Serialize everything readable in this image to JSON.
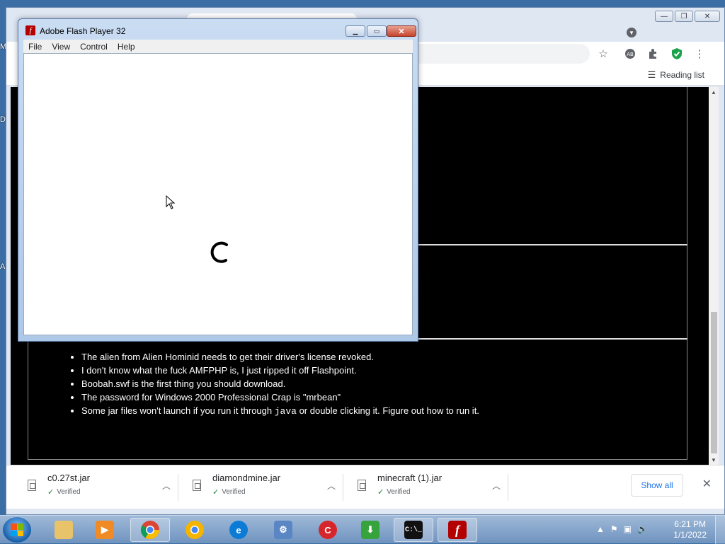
{
  "desktop": {
    "edge_letters": [
      "M",
      "D",
      "A"
    ]
  },
  "browser": {
    "window_controls": {
      "minimize": "▭",
      "maximize": "▭",
      "close": "✕"
    },
    "reading_list_label": "Reading list",
    "notes": [
      "The alien from Alien Hominid needs to get their driver's license revoked.",
      "I don't know what the fuck AMFPHP is, I just ripped it off Flashpoint.",
      "Boobah.swf is the first thing you should download.",
      "The password for Windows 2000 Professional Crap is \"mrbean\""
    ],
    "note5": {
      "before": "Some jar files won't launch if you run it through ",
      "code": "java",
      "after": " or double clicking it. Figure out how to run it."
    }
  },
  "downloads": {
    "items": [
      {
        "name": "c0.27st.jar",
        "status": "Verified"
      },
      {
        "name": "diamondmine.jar",
        "status": "Verified"
      },
      {
        "name": "minecraft (1).jar",
        "status": "Verified"
      }
    ],
    "show_all": "Show all"
  },
  "flash_player": {
    "title": "Adobe Flash Player 32",
    "app_icon": "f",
    "menu": [
      "File",
      "View",
      "Control",
      "Help"
    ]
  },
  "taskbar": {
    "apps": [
      "windows-explorer-icon",
      "media-player-icon",
      "chrome-icon",
      "chrome-canary-icon",
      "edge-icon",
      "control-panel-icon",
      "ccleaner-icon",
      "downloader-icon",
      "cmd-icon",
      "flash-player-icon"
    ],
    "cmd_label": "C:\\_",
    "flash_label": "f",
    "clock": {
      "time": "6:21 PM",
      "date": "1/1/2022"
    }
  },
  "colors": {
    "page_bg": "#000000",
    "link_blue": "#1a73e8",
    "verified_green": "#188038",
    "flash_red": "#b30000"
  }
}
